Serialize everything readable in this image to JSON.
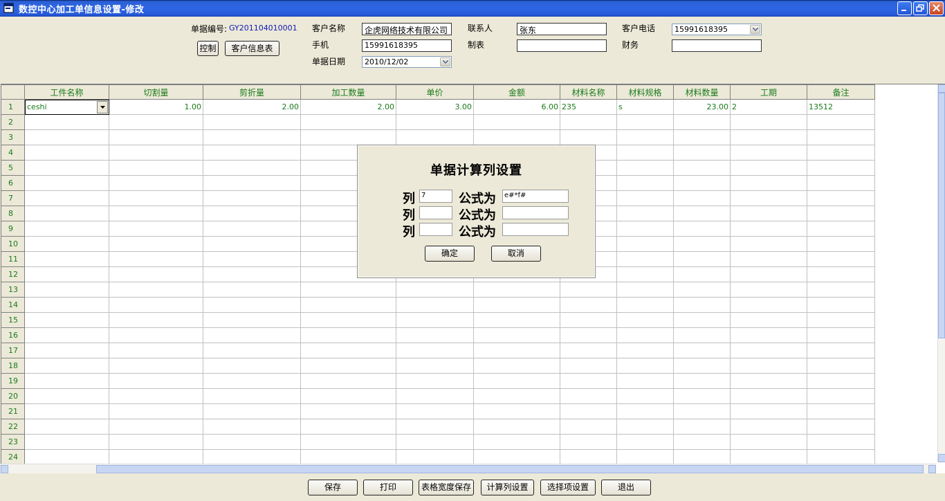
{
  "window": {
    "title": "数控中心加工单信息设置-修改"
  },
  "header": {
    "doc_no_label": "单据编号:",
    "doc_no_value": "GY201104010001",
    "control_button": "控制",
    "customer_info_button": "客户信息表",
    "customer_name_label": "客户名称",
    "customer_name_value": "企虎网络技术有限公司",
    "contact_label": "联系人",
    "contact_value": "张东",
    "customer_phone_label": "客户电话",
    "customer_phone_value": "15991618395",
    "mobile_label": "手机",
    "mobile_value": "15991618395",
    "maker_label": "制表",
    "maker_value": "",
    "finance_label": "财务",
    "finance_value": "",
    "date_label": "单据日期",
    "date_value": "2010/12/02"
  },
  "grid": {
    "columns": [
      "工件名称",
      "切割量",
      "剪折量",
      "加工数量",
      "单价",
      "金额",
      "材料名称",
      "材料规格",
      "材料数量",
      "工期",
      "备注"
    ],
    "rows": [
      [
        "ceshi",
        "1.00",
        "2.00",
        "2.00",
        "3.00",
        "6.00",
        "235",
        "s",
        "23.00",
        "2",
        "13512"
      ]
    ],
    "row_numbers": [
      "1",
      "2",
      "3",
      "4",
      "5",
      "6",
      "7",
      "8",
      "9",
      "10",
      "11",
      "12",
      "13",
      "14",
      "15",
      "16",
      "17",
      "18",
      "19",
      "20",
      "21",
      "22",
      "23",
      "24"
    ]
  },
  "dialog": {
    "title": "单据计算列设置",
    "col_label": "列",
    "formula_label": "公式为",
    "rows": [
      {
        "col": "7",
        "formula": "e#*f#"
      },
      {
        "col": "",
        "formula": ""
      },
      {
        "col": "",
        "formula": ""
      }
    ],
    "ok_button": "确定",
    "cancel_button": "取消"
  },
  "toolbar": {
    "save": "保存",
    "print": "打印",
    "save_width": "表格宽度保存",
    "calc_col": "计算列设置",
    "option": "选择项设置",
    "exit": "退出"
  }
}
